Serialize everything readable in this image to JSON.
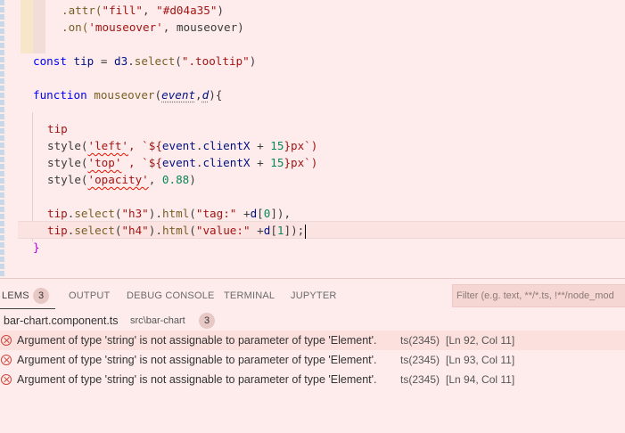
{
  "editor": {
    "lines": {
      "l1": [
        ".attr(",
        "\"fill\"",
        ", ",
        "\"#d04a35\"",
        ")"
      ],
      "l2": [
        ".on(",
        "'mouseover'",
        ", mouseover)"
      ],
      "l3": [
        "const",
        " ",
        "tip",
        " = ",
        "d3",
        ".",
        "select",
        "(",
        "\".tooltip\"",
        ")"
      ],
      "l4": [
        "function",
        " ",
        "mouseover",
        "(",
        "event",
        ",",
        "d",
        "){"
      ],
      "l5": [
        "tip"
      ],
      "l6": [
        "style(",
        "'left'",
        ", `${",
        "event",
        ".",
        "clientX",
        " + ",
        "15",
        "}px`)"
      ],
      "l7": [
        "style(",
        "'top'",
        " , `${",
        "event",
        ".",
        "clientX",
        " + ",
        "15",
        "}px`)"
      ],
      "l8": [
        "style(",
        "'opacity'",
        ", ",
        "0.88",
        ")"
      ],
      "l9": [
        "tip",
        ".",
        "select",
        "(",
        "\"h3\"",
        ").",
        "html",
        "(",
        "\"tag:\"",
        " +",
        "d",
        "[",
        "0",
        "]),"
      ],
      "l10": [
        "tip",
        ".",
        "select",
        "(",
        "\"h4\"",
        ").",
        "html",
        "(",
        "\"value:\"",
        " +",
        "d",
        "[",
        "1",
        "]);"
      ],
      "l11": [
        "}"
      ]
    }
  },
  "panel": {
    "tabs": {
      "problems": "LEMS",
      "problems_count": "3",
      "output": "OUTPUT",
      "debug": "DEBUG CONSOLE",
      "terminal": "TERMINAL",
      "jupyter": "JUPYTER"
    },
    "filter_placeholder": "Filter (e.g. text, **/*.ts, !**/node_mod",
    "file": {
      "name": "bar-chart.component.ts",
      "path": "src\\bar-chart",
      "count": "3"
    },
    "errors": [
      {
        "message": "Argument of type 'string' is not assignable to parameter of type 'Element'.",
        "code": "ts(2345)",
        "location": "[Ln 92, Col 11]"
      },
      {
        "message": "Argument of type 'string' is not assignable to parameter of type 'Element'.",
        "code": "ts(2345)",
        "location": "[Ln 93, Col 11]"
      },
      {
        "message": "Argument of type 'string' is not assignable to parameter of type 'Element'.",
        "code": "ts(2345)",
        "location": "[Ln 94, Col 11]"
      }
    ]
  },
  "colors": {
    "background": "#fdeceb",
    "error": "#d0453a",
    "keyword": "#0000ff",
    "string": "#a31515",
    "variable": "#001080",
    "number": "#098658"
  }
}
